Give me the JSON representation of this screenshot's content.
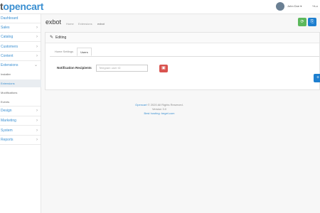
{
  "header": {
    "logo_text": "opencart",
    "logo_prefix": "t",
    "user_name": "John Doe",
    "user_caret": "▾",
    "logout_label": "Lo"
  },
  "sidebar": {
    "items": [
      {
        "label": "Dashboard"
      },
      {
        "label": "Sales",
        "chevron": "›"
      },
      {
        "label": "Catalog",
        "chevron": "›"
      },
      {
        "label": "Customers",
        "chevron": "›"
      },
      {
        "label": "Content",
        "chevron": "›"
      },
      {
        "label": "Extensions",
        "chevron": "⌄"
      },
      {
        "label": "Design",
        "chevron": "›"
      },
      {
        "label": "Marketing",
        "chevron": "›"
      },
      {
        "label": "System",
        "chevron": "›"
      },
      {
        "label": "Reports",
        "chevron": "›"
      }
    ],
    "sub_items": [
      {
        "label": "Installer"
      },
      {
        "label": "Extensions"
      },
      {
        "label": "Modifications"
      },
      {
        "label": "Events"
      }
    ]
  },
  "page": {
    "title": "exbot",
    "breadcrumbs": [
      "Home",
      "Extensions",
      "exbot"
    ]
  },
  "toolbar": {
    "save_icon": "⟳",
    "back_icon": "⎘"
  },
  "panel": {
    "title": "Editing",
    "tabs": [
      {
        "label": "Home Settings"
      },
      {
        "label": "Users"
      }
    ],
    "field_label": "Notification Recipients",
    "field_placeholder": "Telegram user ID",
    "delete_icon": "▣",
    "add_icon": "+"
  },
  "footer": {
    "line1_brand": "Opencart",
    "line1_rest": " © 2020 All Rights Reserved.",
    "line2": "Version 3.0",
    "line3": "Best hosting: beget.com"
  },
  "colors": {
    "accent": "#3a8fd1",
    "save": "#5cb85c",
    "primary": "#1e7fcf",
    "danger": "#d9534f"
  }
}
